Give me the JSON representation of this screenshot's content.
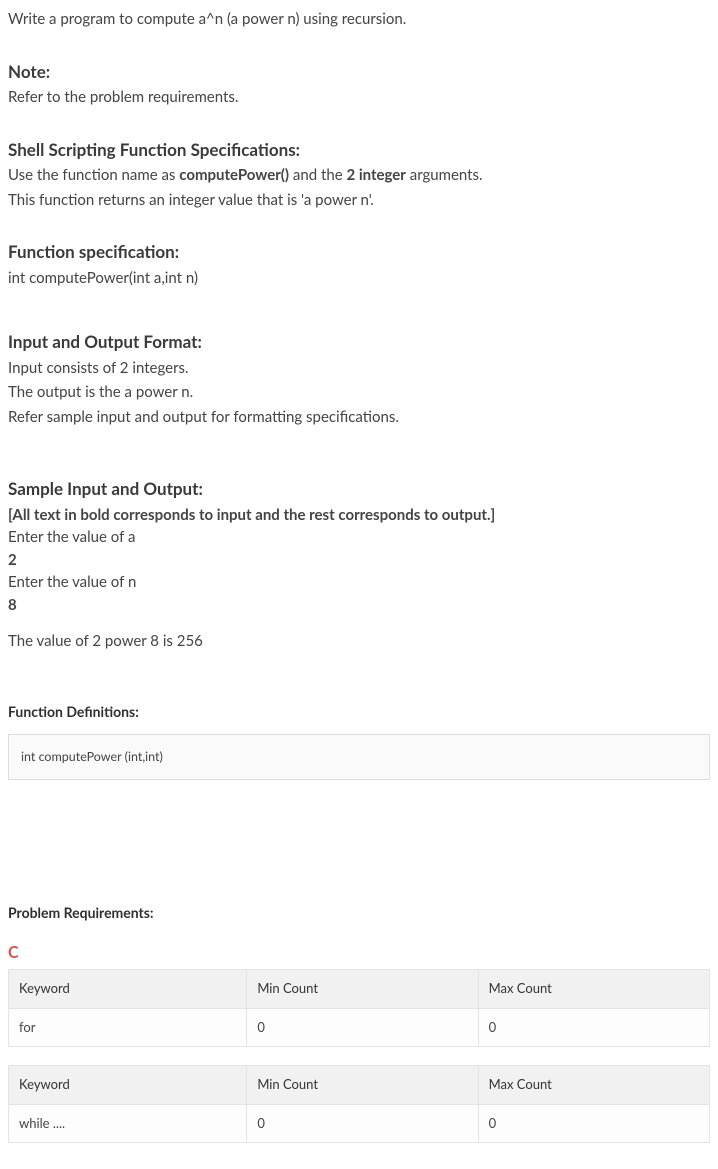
{
  "intro": "Write a program to compute a^n (a power n) using recursion.",
  "note": {
    "heading": "Note:",
    "text": "Refer to the problem requirements."
  },
  "shellSpec": {
    "heading": "Shell Scripting Function Specifications:",
    "line1_pre": "Use the function name as ",
    "line1_fn": "computePower()",
    "line1_mid": " and the ",
    "line1_args": "2 integer",
    "line1_post": " arguments.",
    "line2": "This function returns an integer value that is 'a power n'."
  },
  "funcSpec": {
    "heading": "Function specification:",
    "signature": "int computePower(int a,int n)"
  },
  "ioFormat": {
    "heading": "Input and Output Format:",
    "l1": "Input consists of 2 integers.",
    "l2": "The output is the a power n.",
    "l3": "Refer sample input and output for formatting specifications."
  },
  "sample": {
    "heading": "Sample Input and Output:",
    "note": "[All text in bold corresponds to input and the rest corresponds to output.]",
    "p1": "Enter the value of a",
    "v1": "2",
    "p2": "Enter the value of n",
    "v2": "8",
    "result": "The value of 2 power 8 is 256"
  },
  "funcDefs": {
    "heading": "Function Definitions:",
    "code": "int computePower (int,int)"
  },
  "probReq": {
    "heading": "Problem Requirements:",
    "lang": "C",
    "headers": {
      "kw": "Keyword",
      "min": "Min Count",
      "max": "Max Count"
    },
    "tables": [
      {
        "keyword": "for",
        "min": "0",
        "max": "0"
      },
      {
        "keyword": "while ....",
        "min": "0",
        "max": "0"
      }
    ]
  }
}
